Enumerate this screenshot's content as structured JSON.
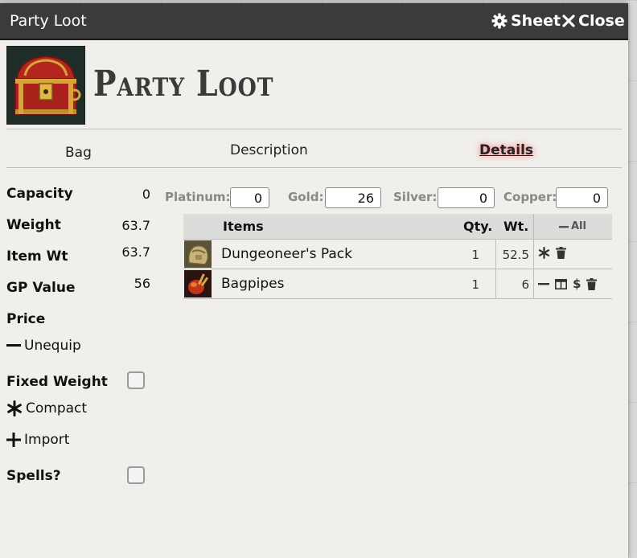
{
  "window": {
    "title": "Party Loot",
    "sheet_label": "Sheet",
    "close_label": "Close"
  },
  "header": {
    "title": "Party Loot",
    "image": "treasure-chest"
  },
  "tabs": [
    {
      "label": "Bag",
      "active": false
    },
    {
      "label": "Description",
      "active": false
    },
    {
      "label": "Details",
      "active": true
    }
  ],
  "stats": {
    "capacity": {
      "label": "Capacity",
      "value": "0"
    },
    "weight": {
      "label": "Weight",
      "value": "63.7"
    },
    "item_wt": {
      "label": "Item Wt",
      "value": "63.7"
    },
    "gp_value": {
      "label": "GP Value",
      "value": "56"
    },
    "price": {
      "label": "Price"
    }
  },
  "actions": {
    "unequip": "Unequip",
    "fixed_weight": "Fixed Weight",
    "compact": "Compact",
    "import": "Import",
    "spells": "Spells?"
  },
  "currency": {
    "platinum": {
      "label": "Platinum:",
      "value": "0"
    },
    "gold": {
      "label": "Gold:",
      "value": "26"
    },
    "silver": {
      "label": "Silver:",
      "value": "0"
    },
    "copper": {
      "label": "Copper:",
      "value": "0"
    }
  },
  "items_table": {
    "headers": {
      "items": "Items",
      "qty": "Qty.",
      "wt": "Wt.",
      "all": "All"
    },
    "rows": [
      {
        "name": "Dungeoneer's Pack",
        "qty": "1",
        "wt": "52.5",
        "icon": "pack-icon"
      },
      {
        "name": "Bagpipes",
        "qty": "1",
        "wt": "6",
        "icon": "bagpipes-icon"
      }
    ]
  },
  "colors": {
    "titlebar": "#3b3b3b",
    "panel": "#f0efec",
    "tab_glow": "#ff8c8c"
  }
}
